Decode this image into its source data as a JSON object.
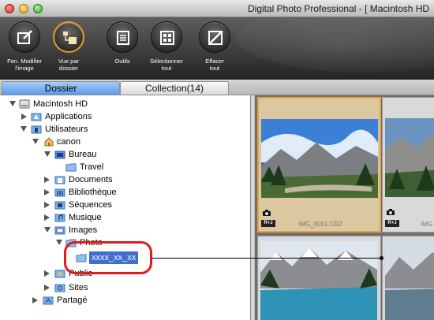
{
  "window": {
    "title": "Digital Photo Professional - [ Macintosh HD"
  },
  "toolbar": {
    "items": [
      {
        "label": "Fen. Modifier\nl'image",
        "icon": "edit-image-icon",
        "active": false
      },
      {
        "label": "Vue par\ndossier",
        "icon": "folder-view-icon",
        "active": true
      },
      {
        "label": "Outils",
        "icon": "tools-icon",
        "active": false
      },
      {
        "label": "Sélectionner\ntout",
        "icon": "select-all-icon",
        "active": false
      },
      {
        "label": "Effacer\ntout",
        "icon": "clear-all-icon",
        "active": false
      }
    ]
  },
  "tabs": {
    "folder": "Dossier",
    "collection": "Collection(14)"
  },
  "tree": {
    "items": [
      {
        "label": "Macintosh HD",
        "icon": "hard-drive-icon",
        "state": "open"
      },
      {
        "label": "Applications",
        "icon": "applications-folder-icon",
        "state": "closed"
      },
      {
        "label": "Utilisateurs",
        "icon": "users-folder-icon",
        "state": "open"
      },
      {
        "label": "canon",
        "icon": "home-folder-icon",
        "state": "open"
      },
      {
        "label": "Bureau",
        "icon": "desktop-folder-icon",
        "state": "open"
      },
      {
        "label": "Travel",
        "icon": "folder-icon",
        "state": "none"
      },
      {
        "label": "Documents",
        "icon": "documents-folder-icon",
        "state": "closed"
      },
      {
        "label": "Bibliothèque",
        "icon": "library-folder-icon",
        "state": "closed"
      },
      {
        "label": "Séquences",
        "icon": "movies-folder-icon",
        "state": "closed"
      },
      {
        "label": "Musique",
        "icon": "music-folder-icon",
        "state": "closed"
      },
      {
        "label": "Images",
        "icon": "pictures-folder-icon",
        "state": "open"
      },
      {
        "label": "Photo",
        "icon": "folder-icon",
        "state": "open"
      },
      {
        "label": "xxxx_xx_xx",
        "icon": "folder-icon",
        "state": "none",
        "selected": true
      },
      {
        "label": "Public",
        "icon": "public-folder-icon",
        "state": "closed"
      },
      {
        "label": "Sites",
        "icon": "sites-folder-icon",
        "state": "closed"
      },
      {
        "label": "Partagé",
        "icon": "shared-folder-icon",
        "state": "closed"
      }
    ]
  },
  "thumbnails": [
    {
      "name": "IMG_0001.CR2",
      "badge": "R+J",
      "selected": true
    },
    {
      "name": "IMG",
      "badge": "R+J",
      "selected": false
    }
  ],
  "colors": {
    "selection": "#3f6fd0",
    "callout": "#e21b1b",
    "thumb_selected_border": "#e8a23a"
  }
}
